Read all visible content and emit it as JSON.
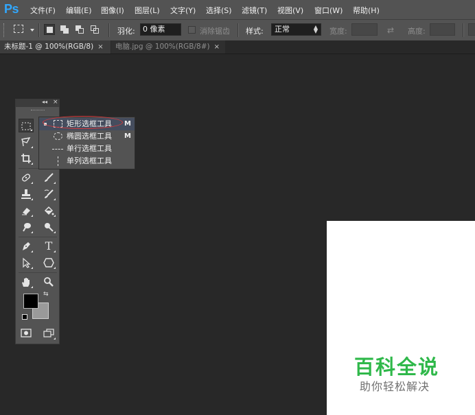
{
  "app": {
    "logo": "Ps"
  },
  "menu": [
    "文件(F)",
    "编辑(E)",
    "图像(I)",
    "图层(L)",
    "文字(Y)",
    "选择(S)",
    "滤镜(T)",
    "视图(V)",
    "窗口(W)",
    "帮助(H)"
  ],
  "options": {
    "feather_label": "羽化:",
    "feather_value": "0 像素",
    "antialias_label": "消除锯齿",
    "style_label": "样式:",
    "style_value": "正常",
    "width_label": "宽度:",
    "height_label": "高度:"
  },
  "tabs": [
    {
      "label": "未标题-1 @ 100%(RGB/8)",
      "close": "×",
      "active": true
    },
    {
      "label": "电脑.jpg @ 100%(RGB/8#)",
      "close": "×",
      "active": false
    }
  ],
  "toolbox": {
    "collapse": "◂◂",
    "close": "×",
    "tools": [
      "rectangular-marquee",
      "lasso",
      "crop",
      "spot-healing-brush",
      "brush",
      "clone-stamp",
      "history-brush",
      "eraser",
      "paint-bucket",
      "blur",
      "dodge",
      "pen",
      "type",
      "path-selection",
      "shape",
      "hand",
      "zoom",
      "quick-mask",
      "screen-mode"
    ],
    "type_glyph": "T",
    "foreground_color": "#000000",
    "background_color": "#9a9a9a"
  },
  "flyout": {
    "items": [
      {
        "label": "矩形选框工具",
        "shortcut": "M",
        "selected": true
      },
      {
        "label": "椭圆选框工具",
        "shortcut": "M",
        "selected": false
      },
      {
        "label": "单行选框工具",
        "shortcut": "",
        "selected": false
      },
      {
        "label": "单列选框工具",
        "shortcut": "",
        "selected": false
      }
    ]
  },
  "watermark": {
    "main": "百科全说",
    "sub": "助你轻松解决"
  },
  "colors": {
    "accent": "#31a8ff",
    "highlight": "#d8393c",
    "watermark": "#2fb84a"
  }
}
